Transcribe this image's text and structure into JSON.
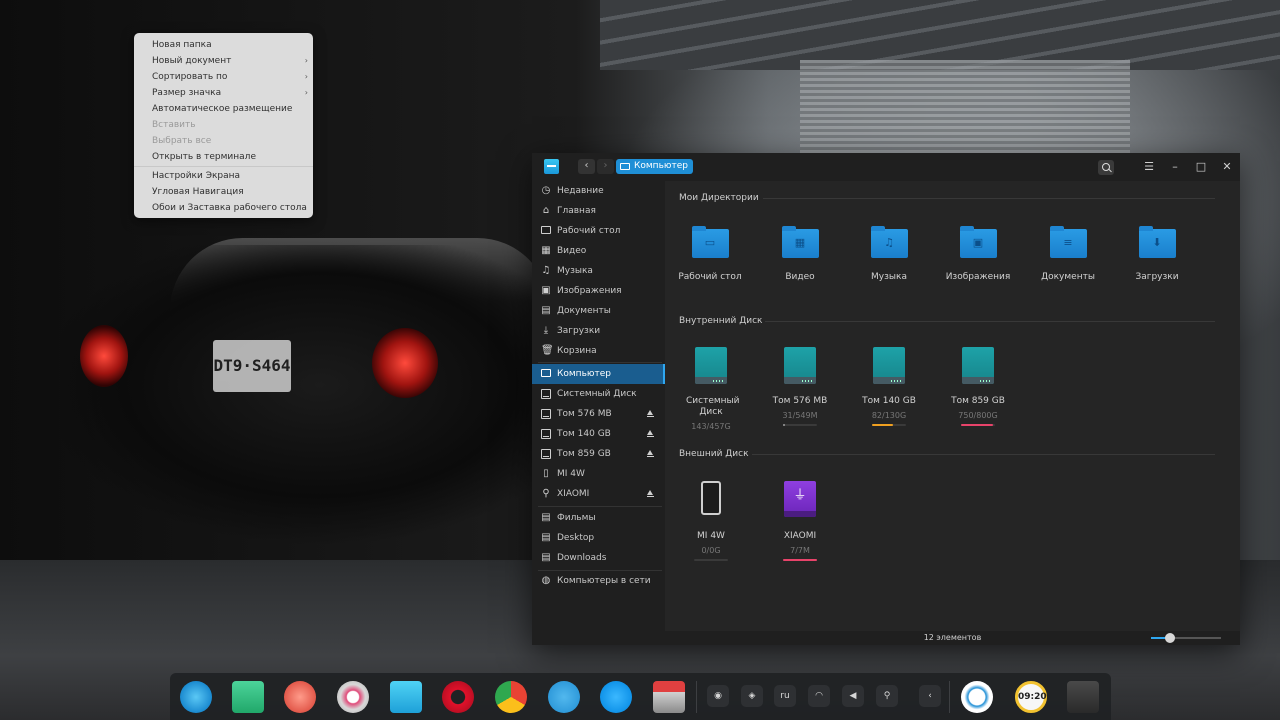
{
  "context_menu": {
    "items": [
      {
        "label": "Новая папка",
        "submenu": false,
        "disabled": false
      },
      {
        "label": "Новый документ",
        "submenu": true,
        "disabled": false
      },
      {
        "label": "Сортировать по",
        "submenu": true,
        "disabled": false
      },
      {
        "label": "Размер значка",
        "submenu": true,
        "disabled": false
      },
      {
        "label": "Автоматическое размещение",
        "submenu": false,
        "disabled": false
      },
      {
        "label": "Вставить",
        "submenu": false,
        "disabled": true
      },
      {
        "label": "Выбрать все",
        "submenu": false,
        "disabled": true
      },
      {
        "label": "Открыть в терминале",
        "submenu": false,
        "disabled": false
      },
      {
        "label": "Настройки Экрана",
        "submenu": false,
        "disabled": false
      },
      {
        "label": "Угловая Навигация",
        "submenu": false,
        "disabled": false
      },
      {
        "label": "Обои и Заставка рабочего стола",
        "submenu": false,
        "disabled": false
      }
    ],
    "submenu_arrow": "›"
  },
  "wallpaper": {
    "plate_text": "DT9·S464"
  },
  "file_manager": {
    "nav": {
      "back": "‹",
      "forward": "›"
    },
    "breadcrumb": "Компьютер",
    "window_buttons": {
      "menu": "☰",
      "minimize": "–",
      "maximize": "□",
      "close": "✕"
    },
    "sidebar": {
      "items": [
        {
          "label": "Недавние",
          "icon": "clock-icon",
          "eject": false
        },
        {
          "label": "Главная",
          "icon": "home-icon",
          "eject": false
        },
        {
          "label": "Рабочий стол",
          "icon": "desktop-icon",
          "eject": false
        },
        {
          "label": "Видео",
          "icon": "video-icon",
          "eject": false
        },
        {
          "label": "Музыка",
          "icon": "music-icon",
          "eject": false
        },
        {
          "label": "Изображения",
          "icon": "image-icon",
          "eject": false
        },
        {
          "label": "Документы",
          "icon": "document-icon",
          "eject": false
        },
        {
          "label": "Загрузки",
          "icon": "download-icon",
          "eject": false
        },
        {
          "label": "Корзина",
          "icon": "trash-icon",
          "eject": false
        },
        {
          "label": "Компьютер",
          "icon": "computer-icon",
          "eject": false,
          "active": true
        },
        {
          "label": "Системный Диск",
          "icon": "drive-icon",
          "eject": false
        },
        {
          "label": "Том 576 MB",
          "icon": "drive-icon",
          "eject": true
        },
        {
          "label": "Том 140 GB",
          "icon": "drive-icon",
          "eject": true
        },
        {
          "label": "Том 859 GB",
          "icon": "drive-icon",
          "eject": true
        },
        {
          "label": "MI 4W",
          "icon": "phone-icon",
          "eject": false
        },
        {
          "label": "XIAOMI",
          "icon": "usb-icon",
          "eject": true
        },
        {
          "label": "Фильмы",
          "icon": "folder-icon",
          "eject": false
        },
        {
          "label": "Desktop",
          "icon": "folder-icon",
          "eject": false
        },
        {
          "label": "Downloads",
          "icon": "folder-icon",
          "eject": false
        },
        {
          "label": "Компьютеры в сети",
          "icon": "network-icon",
          "eject": false
        }
      ]
    },
    "sections": {
      "my_dirs": "Мои Директории",
      "internal": "Внутренний Диск",
      "external": "Внешний Диск"
    },
    "folders": [
      {
        "label": "Рабочий стол",
        "glyph": "▭"
      },
      {
        "label": "Видео",
        "glyph": "▦"
      },
      {
        "label": "Музыка",
        "glyph": "♫"
      },
      {
        "label": "Изображения",
        "glyph": "▣"
      },
      {
        "label": "Документы",
        "glyph": "≡"
      },
      {
        "label": "Загрузки",
        "glyph": "⬇"
      }
    ],
    "internal_disks": [
      {
        "label": "Системный Диск",
        "usage": "143/457G",
        "fraction": 0.31,
        "color": "#3a3a3a"
      },
      {
        "label": "Том 576 MB",
        "usage": "31/549M",
        "fraction": 0.06,
        "color": "#9a9a9a"
      },
      {
        "label": "Том 140 GB",
        "usage": "82/130G",
        "fraction": 0.63,
        "color": "#f0a020"
      },
      {
        "label": "Том 859 GB",
        "usage": "750/800G",
        "fraction": 0.94,
        "color": "#e8436a"
      }
    ],
    "external_disks": [
      {
        "label": "MI 4W",
        "usage": "0/0G",
        "fraction": 0,
        "color": "#3a3a3a",
        "kind": "phone"
      },
      {
        "label": "XIAOMI",
        "usage": "7/7M",
        "fraction": 1,
        "color": "#e8436a",
        "kind": "usb",
        "glyph": "⏚"
      }
    ],
    "status": "12 элементов",
    "zoom_level": 0.27
  },
  "dock": {
    "apps": [
      "deepin-launcher-icon",
      "multitasking-icon",
      "screen-recorder-icon",
      "settings-icon",
      "file-manager-icon",
      "opera-icon",
      "chrome-icon",
      "telegram-icon",
      "skype-icon",
      "installer-icon"
    ],
    "tray": {
      "lang": "ru",
      "collapse": "‹"
    },
    "clock": "09:20",
    "accent": "#1f8fd6"
  }
}
